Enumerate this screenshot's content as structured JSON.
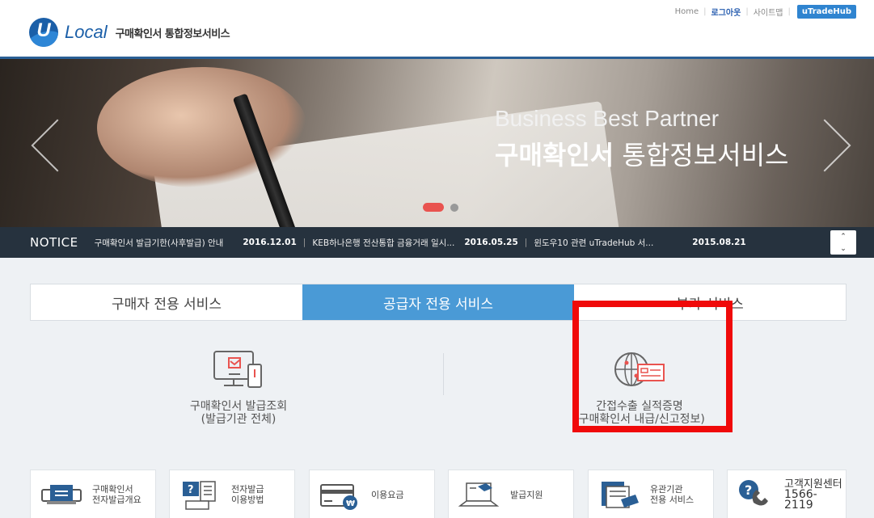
{
  "header": {
    "logo_mark": "U",
    "logo_word": "Local",
    "logo_sub": "구매확인서 통합정보서비스",
    "util_links": {
      "home": "Home",
      "logout": "로그아웃",
      "sitemap": "사이트맵",
      "hub": "uTradeHub"
    }
  },
  "hero": {
    "line1": "Business Best Partner",
    "line2_bold": "구매확인서",
    "line2_rest": " 통합정보서비스",
    "slide_count": 2,
    "active_slide": 1
  },
  "notice": {
    "title": "NOTICE",
    "items": [
      {
        "text": "구매확인서 발급기한(사후발급) 안내",
        "date": "2016.12.01"
      },
      {
        "text": "KEB하나은행 전산통합 금융거래 일시...",
        "date": "2016.05.25"
      },
      {
        "text": "윈도우10 관련 uTradeHub 서...",
        "date": "2015.08.21"
      }
    ],
    "up_icon": "chevron-up-icon",
    "down_icon": "chevron-down-icon"
  },
  "tabs": [
    {
      "label": "구매자 전용 서비스",
      "active": false
    },
    {
      "label": "공급자 전용 서비스",
      "active": true
    },
    {
      "label": "부가 서비스",
      "active": false
    }
  ],
  "services": [
    {
      "line1": "구매확인서 발급조회",
      "line2": "(발급기관 전체)",
      "icon": "monitor-mobile-icon"
    },
    {
      "line1": "간접수출 실적증명",
      "line2": "(구매확인서 내급/신고정보)",
      "icon": "globe-card-icon"
    }
  ],
  "quick_links": [
    {
      "line1": "구매확인서",
      "line2": "전자발급개요",
      "icon": "scanner-icon"
    },
    {
      "line1": "전자발급",
      "line2": "이용방법",
      "icon": "help-computer-icon"
    },
    {
      "line1": "이용요금",
      "line2": "",
      "icon": "card-won-icon"
    },
    {
      "line1": "발급지원",
      "line2": "",
      "icon": "laptop-book-icon"
    },
    {
      "line1": "유관기관",
      "line2": "전용 서비스",
      "icon": "documents-icon"
    },
    {
      "line1": "고객지원센터",
      "line2": "1566-2119",
      "icon": "phone-help-icon"
    }
  ],
  "colors": {
    "brand_blue": "#1b5fa8",
    "active_tab": "#4a9ad6",
    "notice_bg": "#26323e",
    "highlight": "#f00a0a"
  }
}
